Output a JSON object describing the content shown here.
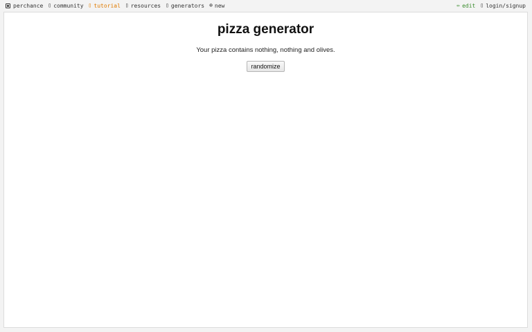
{
  "nav": {
    "left": [
      {
        "name": "perchance",
        "icon": "dice-icon",
        "label": "perchance"
      },
      {
        "name": "community",
        "icon": "chat-icon",
        "label": "community"
      },
      {
        "name": "tutorial",
        "icon": "book-icon",
        "label": "tutorial"
      },
      {
        "name": "resources",
        "icon": "resources-icon",
        "label": "resources"
      },
      {
        "name": "generators",
        "icon": "generators-icon",
        "label": "generators"
      },
      {
        "name": "new",
        "icon": "plus-circle-icon",
        "label": "new"
      }
    ],
    "right": [
      {
        "name": "edit",
        "icon": "pencil-icon",
        "label": "edit"
      },
      {
        "name": "login-signup",
        "icon": "user-icon",
        "label": "login/signup"
      }
    ]
  },
  "page": {
    "title": "pizza generator",
    "result": "Your pizza contains nothing, nothing and olives.",
    "randomize_label": "randomize"
  },
  "colors": {
    "tutorial": "#e07b00",
    "edit": "#3c8d2f"
  }
}
